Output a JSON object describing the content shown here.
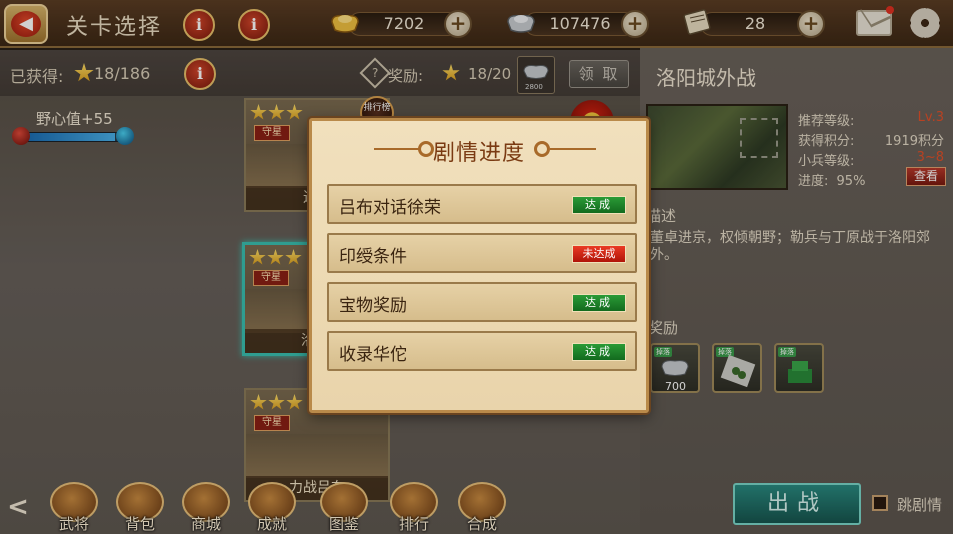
{
  "topbar": {
    "title": "关卡选择",
    "info_glyph": "i",
    "resources": [
      {
        "icon": "gold-ingot-icon",
        "value": "7202"
      },
      {
        "icon": "silver-ingot-icon",
        "value": "107476"
      },
      {
        "icon": "scroll-icon",
        "value": "28"
      }
    ],
    "plus_glyph": "+"
  },
  "subbar": {
    "obtained_label": "已获得:",
    "obtained_value": "18/186",
    "reward_label": "奖励:",
    "reward_value": "18/20",
    "reward_item_value": "2800",
    "claim_label": "领 取"
  },
  "map": {
    "ambition_label": "野心值+55",
    "ambition_progress": 0.9,
    "rank_badge": "排行榜",
    "cards": [
      {
        "guard": "守星",
        "name": "进攻",
        "stars": 3
      },
      {
        "guard": "守星",
        "name": "洛阳",
        "stars": 3
      },
      {
        "guard": "守星",
        "name": "力战吕布",
        "stars": 3
      }
    ]
  },
  "bottom_nav": {
    "left_arrow": "<",
    "items": [
      {
        "label": "武将",
        "icon": "general-icon"
      },
      {
        "label": "背包",
        "icon": "bag-icon"
      },
      {
        "label": "商城",
        "icon": "shop-icon"
      },
      {
        "label": "成就",
        "icon": "achievement-icon"
      },
      {
        "label": "图鉴",
        "icon": "codex-icon"
      },
      {
        "label": "排行",
        "icon": "ranking-icon"
      },
      {
        "label": "合成",
        "icon": "synthesis-icon"
      }
    ]
  },
  "stage": {
    "title": "洛阳城外战",
    "info": [
      {
        "label": "推荐等级:",
        "value": "Lv.3",
        "red": true
      },
      {
        "label": "获得积分:",
        "value": "1919积分",
        "red": false
      },
      {
        "label": "小兵等级:",
        "value": "3~8",
        "red": true
      },
      {
        "label": "进度:",
        "value": "95%",
        "red": false
      }
    ],
    "view_label": "查看",
    "desc_label": "描述",
    "desc_text": "董卓进京，权倾朝野；勒兵与丁原战于洛阳郊外。",
    "reward_label": "奖励",
    "rewards": [
      {
        "tag": "掉落",
        "count": "700",
        "icon": "silver-ingot-icon"
      },
      {
        "tag": "掉落",
        "count": "",
        "icon": "herb-icon"
      },
      {
        "tag": "掉落",
        "count": "",
        "icon": "jade-icon"
      }
    ],
    "fight_label": "出战",
    "skip_label": "跳剧情"
  },
  "modal": {
    "title": "剧情进度",
    "tasks": [
      {
        "label": "吕布对话徐荣",
        "status": "达成",
        "done": true
      },
      {
        "label": "印绶条件",
        "status": "未达成",
        "done": false
      },
      {
        "label": "宝物奖励",
        "status": "达成",
        "done": true
      },
      {
        "label": "收录华佗",
        "status": "达成",
        "done": true
      }
    ]
  },
  "colors": {
    "accent_gold": "#d8a050",
    "status_ok": "#2a9a36",
    "status_fail": "#ea3a24",
    "teal": "#3ac0b0"
  }
}
